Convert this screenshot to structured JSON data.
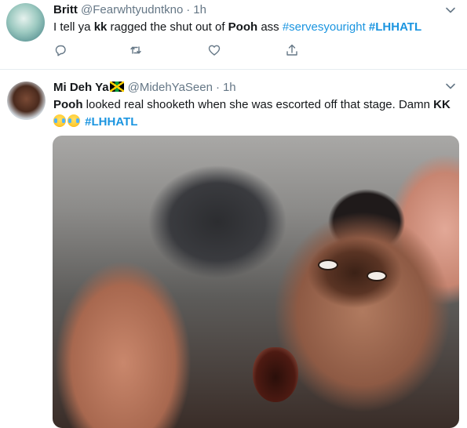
{
  "tweets": [
    {
      "display_name": "Britt",
      "handle": "@Fearwhtyudntkno",
      "separator": "·",
      "time": "1h",
      "text": {
        "p1": "I tell ya ",
        "b1": "kk",
        "p2": " ragged the shut out of ",
        "b2": "Pooh",
        "p3": " ass ",
        "hashtag1": "#servesyouright",
        "hashtag2": "#LHHATL"
      },
      "actions": [
        "reply-icon",
        "retweet-icon",
        "like-icon",
        "share-icon"
      ]
    },
    {
      "display_name": "Mi Deh Ya",
      "flag_icon": "jamaica-flag-icon",
      "handle": "@MidehYaSeen",
      "separator": "·",
      "time": "1h",
      "text": {
        "b1": "Pooh",
        "p1": " looked real shooketh when she was escorted off that stage.  Damn ",
        "b2": "KK",
        "emoji_icon": "tears-of-joy-icon",
        "hashtag": "#LHHATL"
      },
      "media": {
        "description_icon": "gif-image"
      }
    }
  ],
  "colors": {
    "text": "#14171a",
    "secondary": "#657786",
    "link": "#1b95e0",
    "divider": "#e6ecf0"
  }
}
